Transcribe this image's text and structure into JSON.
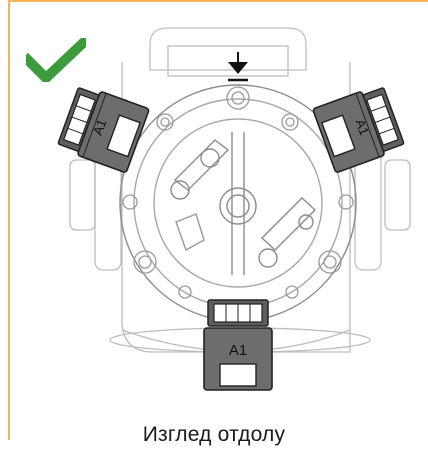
{
  "caption": "Изглед отдолу",
  "connector_label": "A1",
  "check_color": "#3d9a3d",
  "frame_color": "#f2b35a",
  "connector_fill": "#6d6d6d",
  "icons": [
    "check-icon",
    "arrow-down-icon"
  ]
}
